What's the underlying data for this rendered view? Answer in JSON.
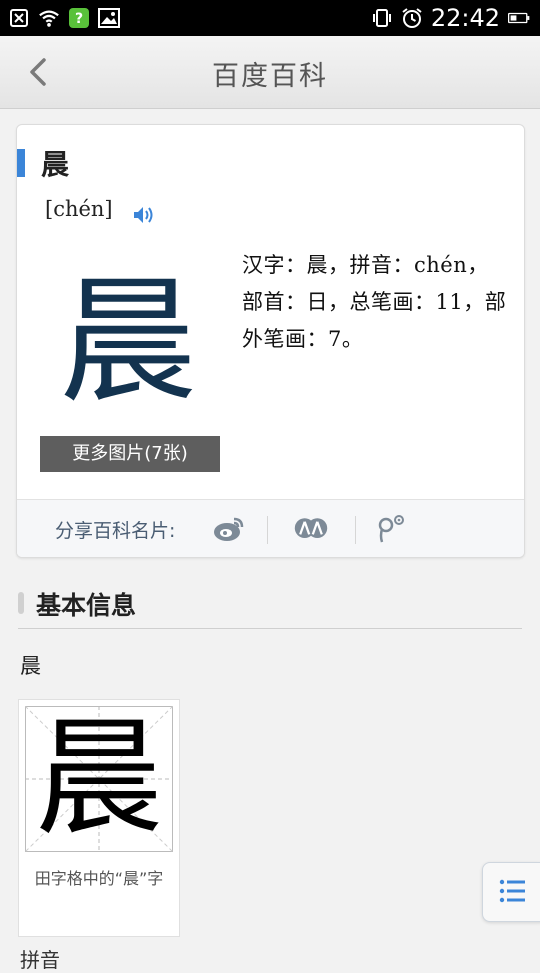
{
  "status_bar": {
    "time": "22:42",
    "left_icons": [
      "close-box-icon",
      "wifi-icon",
      "app-notification-icon",
      "image-icon"
    ],
    "right_icons": [
      "vibrate-icon",
      "alarm-icon",
      "battery-icon"
    ]
  },
  "navbar": {
    "title": "百度百科",
    "back_icon": "chevron-left-icon"
  },
  "card": {
    "word": "晨",
    "pinyin": "[chén]",
    "char_image_text": "晨",
    "more_images_label": "更多图片(7张)",
    "description": "汉字：晨，拼音：chén，部首：日，总笔画：11，部外笔画：7。",
    "share": {
      "label": "分享百科名片:",
      "icons": [
        "weibo-icon",
        "renren-icon",
        "tencent-weibo-icon"
      ]
    }
  },
  "basic_info": {
    "title": "基本信息",
    "char": "晨",
    "grid_char": "晨",
    "caption": "田字格中的“晨”字"
  },
  "peek_text": "拼音",
  "colors": {
    "accent": "#3b85d8",
    "char_image": "#13334f",
    "more_button": "#5e5e5e",
    "share_label": "#4a5d73"
  }
}
